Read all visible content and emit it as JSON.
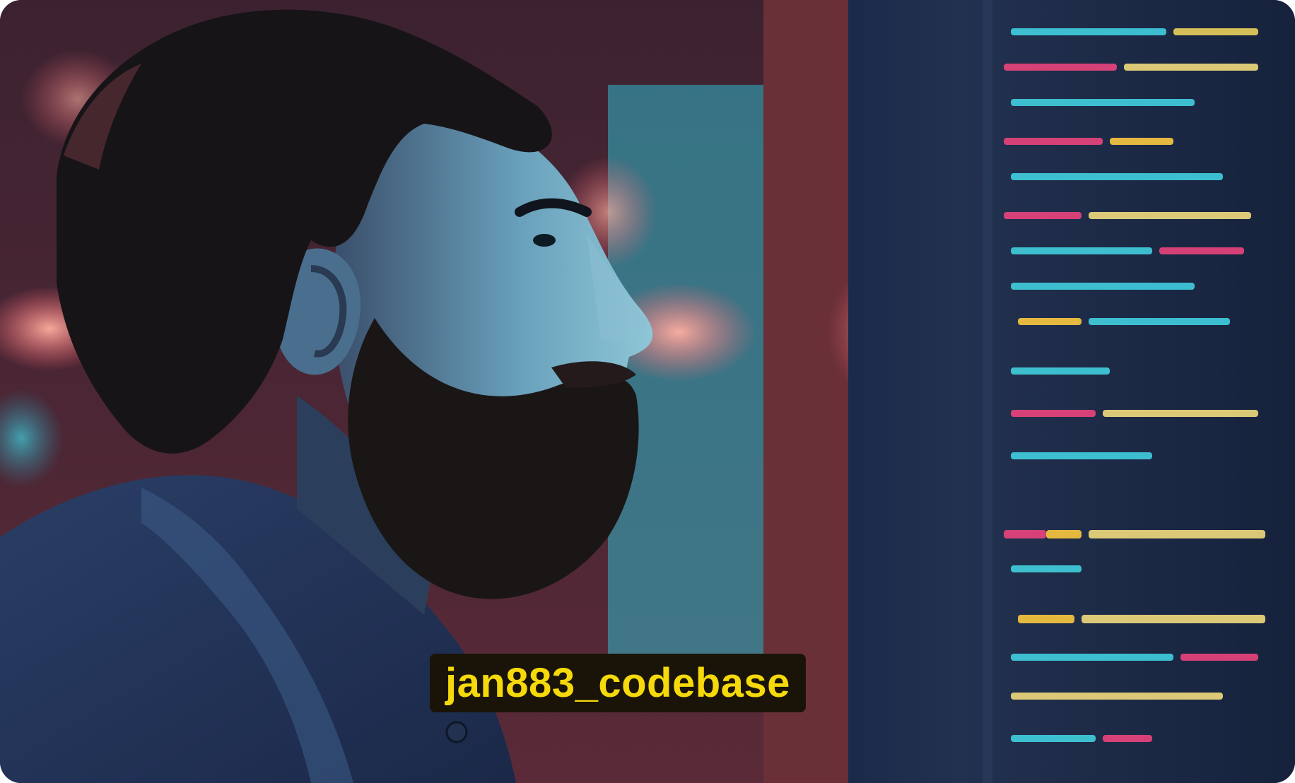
{
  "caption": {
    "text": "jan883_codebase"
  },
  "photo": {
    "subject": "bearded-man-looking-at-code-screen",
    "accent_colors": {
      "cyan": "#29c4d8",
      "magenta": "#e0437a",
      "amber": "#f5d90a",
      "navy": "#0f1a33"
    }
  }
}
